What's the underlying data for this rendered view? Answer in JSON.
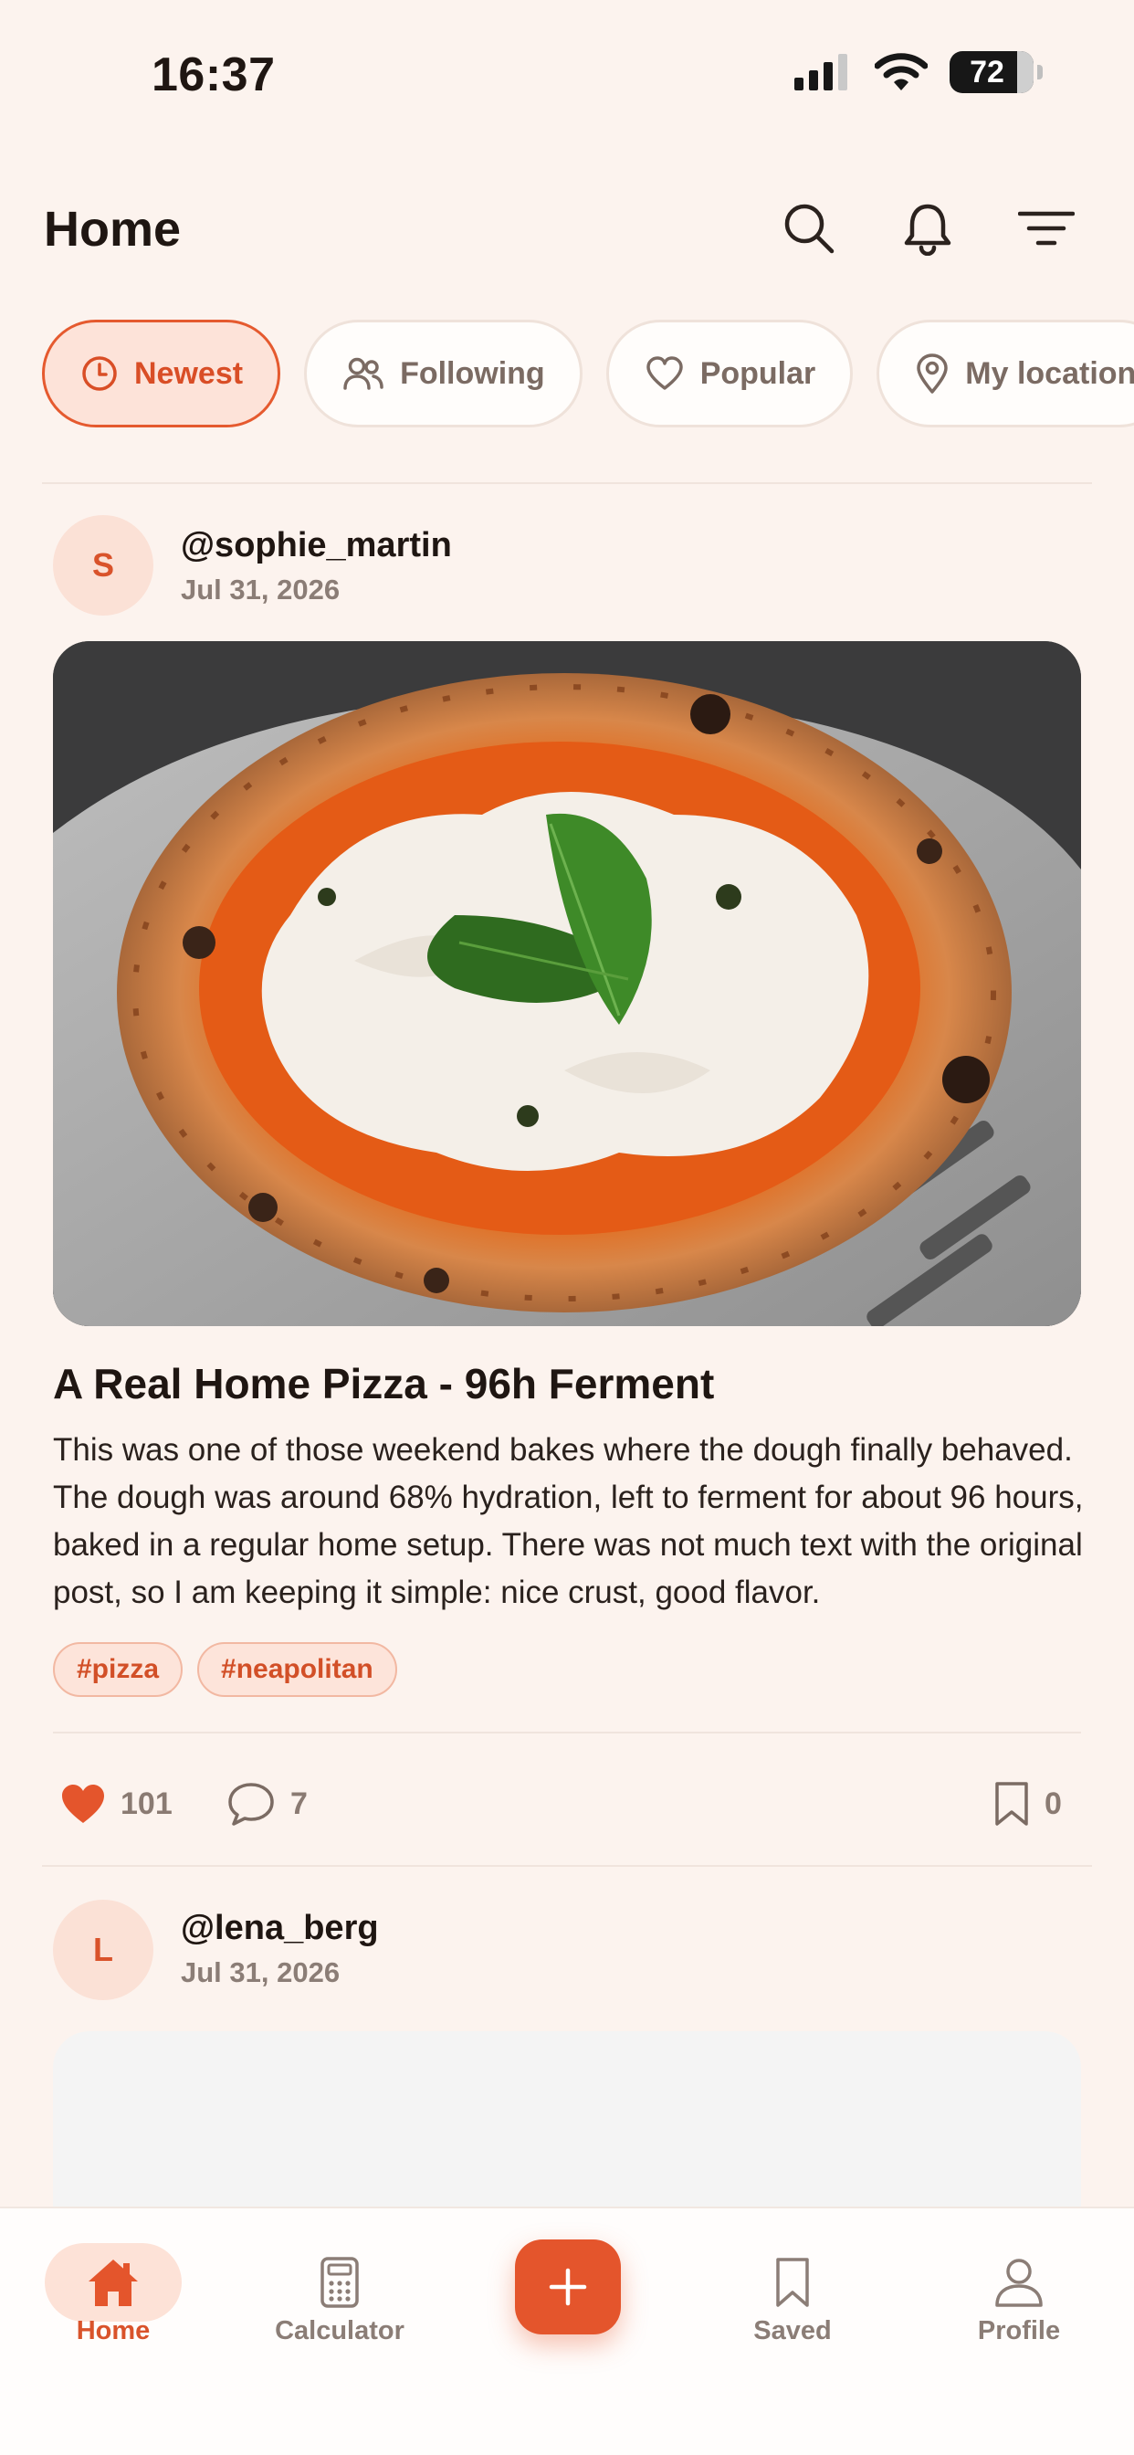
{
  "status_bar": {
    "time": "16:37",
    "battery": "72"
  },
  "header": {
    "title": "Home"
  },
  "filters": [
    {
      "label": "Newest",
      "icon": "clock-icon",
      "active": true
    },
    {
      "label": "Following",
      "icon": "people-icon",
      "active": false
    },
    {
      "label": "Popular",
      "icon": "heart-outline-icon",
      "active": false
    },
    {
      "label": "My location",
      "icon": "location-pin-icon",
      "active": false
    }
  ],
  "posts": [
    {
      "avatar_initial": "S",
      "username": "@sophie_martin",
      "date": "Jul 31, 2026",
      "title": "A Real Home Pizza - 96h Ferment",
      "body": "This was one of those weekend bakes where the dough finally behaved. The dough was around 68% hydration, left to ferment for about 96 hours, baked in a regular home setup. There was not much text with the original post, so I am keeping it simple: nice crust, good flavor.",
      "tags": [
        "#pizza",
        "#neapolitan"
      ],
      "likes": "101",
      "comments": "7",
      "saves": "0"
    },
    {
      "avatar_initial": "L",
      "username": "@lena_berg",
      "date": "Jul 31, 2026"
    }
  ],
  "bottom_nav": {
    "home": "Home",
    "calculator": "Calculator",
    "saved": "Saved",
    "profile": "Profile"
  },
  "colors": {
    "accent": "#e4552c",
    "background": "#fcf3ee",
    "chip_active_bg": "#fde3d9",
    "muted_text": "#8b7d76"
  }
}
